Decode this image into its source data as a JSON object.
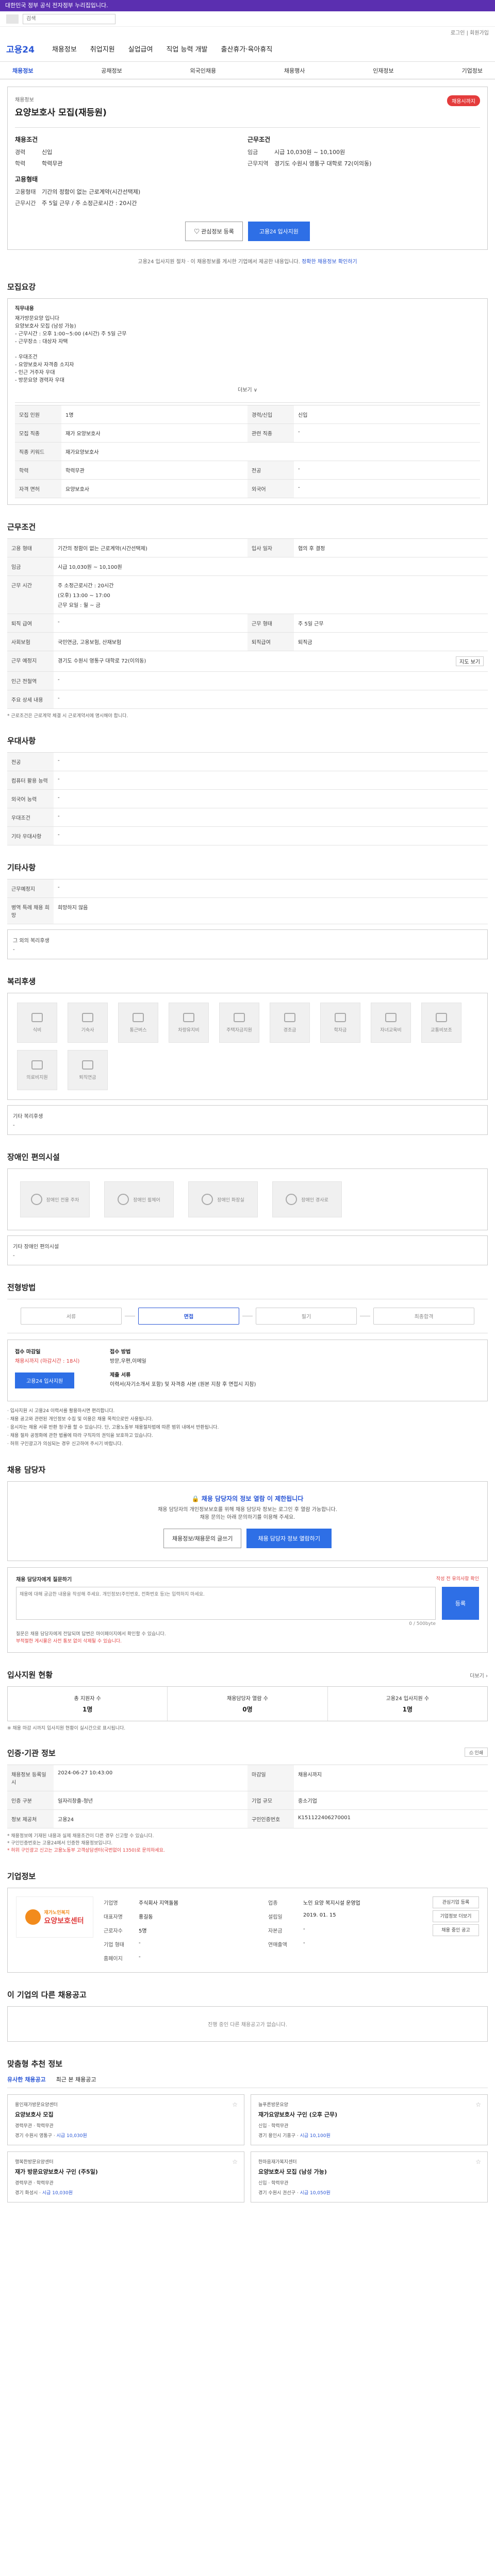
{
  "topbar": {
    "notice": "대한민국 정부 공식 전자정부 누리집입니다."
  },
  "search": {
    "placeholder": "검색"
  },
  "util": {
    "links": "로그인 | 회원가입"
  },
  "gnb": {
    "brand": "고용24",
    "menus": [
      "채용정보",
      "취업지원",
      "실업급여",
      "직업 능력 개발",
      "출산휴가·육아휴직"
    ]
  },
  "subnav": {
    "items": [
      "채용정보",
      "공채정보",
      "외국인채용",
      "채용행사",
      "인재정보",
      "기업정보"
    ],
    "active_index": 0
  },
  "job": {
    "category": "채용정보",
    "title": "요양보호사 모집(재등원)",
    "status": "채용시까지",
    "left_sub": "채용조건",
    "left": [
      {
        "k": "경력",
        "v": "신입"
      },
      {
        "k": "학력",
        "v": "학력무관"
      }
    ],
    "right_sub": "근무조건",
    "right": [
      {
        "k": "임금",
        "v": "시급 10,030원 ~ 10,100원"
      },
      {
        "k": "근무지역",
        "v": "경기도 수원시 영통구 대학로 72(이의동)"
      }
    ],
    "left2_sub": "고용형태",
    "left2": [
      {
        "k": "고용형태",
        "v": "기간의 정함이 없는 근로계약(시간선택제)"
      },
      {
        "k": "근무시간",
        "v": "주 5일 근무 / 주 소정근로시간 : 20시간"
      }
    ],
    "btn_bookmark": "관심정보 등록",
    "btn_apply": "고용24 입사지원",
    "note_pre": "고용24 입사지원 절차 · 이 채용정보를 게시한 기업에서 제공한 내용입니다.",
    "note_link": "정확한 채용정보 확인하기"
  },
  "recruit": {
    "title": "모집요강",
    "desc_label": "직무내용",
    "desc_lines": [
      "재가방문요양 입니다",
      "요양보호사 모집 (남성 가능)",
      "- 근무시간 : 오후 1:00~5:00 (4시간) 주 5일 근무",
      "- 근무장소 : 대상자 자택",
      "",
      "- 우대조건",
      "- 요양보호사 자격증 소지자",
      "- 인근 거주자 우대",
      "- 방문요양 경력자 우대"
    ],
    "more": "더보기 ∨",
    "rows": [
      [
        "모집 인원",
        "1명",
        "경력/신입",
        "신입"
      ],
      [
        "모집 직종",
        "재가 요양보호사",
        "관련 직종",
        "-"
      ],
      [
        "직종 키워드",
        "재가요양보호사",
        "",
        ""
      ],
      [
        "학력",
        "학력무관",
        "전공",
        "-"
      ],
      [
        "자격 면허",
        "요양보호사",
        "외국어",
        "-"
      ]
    ]
  },
  "work": {
    "title": "근무조건",
    "type_label": "고용 형태",
    "type_val": "기간의 정함이 없는 근로계약(시간선택제)",
    "start_label": "입사 일자",
    "start_val": "협의 후 결정",
    "pay_label": "임금",
    "pay_val": "시급 10,030원 ~ 10,100원",
    "hours_label": "근무 시간",
    "hours_val1": "주 소정근로시간 : 20시간",
    "hours_val2": "(오후) 13:00 ~ 17:00",
    "hours_val3": "근무 요일 : 월 ~ 금",
    "rows": [
      [
        "퇴직 급여",
        "-",
        "근무 형태",
        "주 5일 근무"
      ],
      [
        "사회보험",
        "국민연금, 고용보험, 산재보험",
        "퇴직급여",
        "퇴직금"
      ],
      [
        "근무 예정지",
        "경기도 수원시 영통구 대학로 72(이의동)",
        "",
        ""
      ],
      [
        "인근 전철역",
        "-",
        "",
        ""
      ],
      [
        "주요 상세 내용",
        "-",
        "",
        ""
      ]
    ],
    "map_btn": "지도 보기",
    "note": "* 근로조건은 근로계약 체결 시 근로계약서에 명시해야 합니다."
  },
  "pref": {
    "title": "우대사항",
    "rows": [
      [
        "전공",
        "-"
      ],
      [
        "컴퓨터 활용 능력",
        "-"
      ],
      [
        "외국어 능력",
        "-"
      ],
      [
        "우대조건",
        "-"
      ],
      [
        "기타 우대사항",
        "-"
      ]
    ]
  },
  "etc": {
    "title": "기타사항",
    "rows": [
      [
        "근무예정지",
        "-"
      ],
      [
        "병역 특례 채용 희망",
        "희망하지 않음"
      ]
    ],
    "more_label": "그 외의 복리후생",
    "more_val": "-"
  },
  "welfare": {
    "title": "복리후생",
    "tiles": [
      "식비",
      "기숙사",
      "통근버스",
      "차량유지비",
      "주택자금지원",
      "경조금",
      "학자금",
      "자녀교육비",
      "교통비보조",
      "의료비지원",
      "퇴직연금"
    ],
    "other_label": "기타 복리후생",
    "other_val": "-"
  },
  "facility": {
    "title": "장애인 편의시설",
    "tiles": [
      "장애인 전용 주차",
      "장애인 휠체어",
      "장애인 화장실",
      "장애인 경사로"
    ],
    "other_label": "기타 장애인 편의시설",
    "other_val": "-"
  },
  "process": {
    "title": "전형방법",
    "steps": [
      "서류",
      "면접",
      "필기",
      "최종합격"
    ],
    "active_index": 1,
    "apply_period_label": "접수 마감일",
    "apply_period": "채용시까지 (마감시간 : 18시)",
    "method_label": "접수 방법",
    "method": "방문,우편,이메일",
    "docs_label": "제출 서류",
    "docs": "이력서(자기소개서 포함) 및 자격증 사본 (원본 지참 후 면접시 지참)",
    "btn": "고용24 입사지원",
    "bullets": [
      "입사지원 시 고용24 이력서를 활용하시면 편리합니다.",
      "채용 공고와 관련된 개인정보 수집 및 이용은 채용 목적으로만 사용됩니다.",
      "응시자는 채용 서류 반환 청구를 할 수 있습니다. 단, 고용노동부 채용절차법에 따른 범위 내에서 반환됩니다.",
      "채용 절차 공정화에 관한 법률에 따라 구직자의 권익을 보호하고 있습니다.",
      "허위 구인광고가 의심되는 경우 신고하여 주시기 바랍니다."
    ]
  },
  "contact": {
    "title": "채용 담당자",
    "ct": "채용 담당자의 정보 열람 이 제한됩니다",
    "cs1": "채용 담당자의 개인정보보호를 위해 채용 담당자 정보는 로그인 후 열람 가능합니다.",
    "cs2": "채용 문의는 아래 문의하기를 이용해 주세요.",
    "btn1": "채용정보/채용문의 글쓰기",
    "btn2": "채용 담당자 정보 열람하기"
  },
  "qa": {
    "title": "채용 담당자에게 질문하기",
    "warn": "작성 전 유의사항 확인",
    "placeholder": "채용에 대해 궁금한 내용을 작성해 주세요. 개인정보(주민번호, 전화번호 등)는 입력하지 마세요.",
    "counter": "0 / 500byte",
    "reg": "등록",
    "notes": [
      "질문은 채용 담당자에게 전달되며 답변은 마이페이지에서 확인할 수 있습니다.",
      "부적절한 게시물은 사전 통보 없이 삭제될 수 있습니다."
    ]
  },
  "stats": {
    "title": "입사지원 현황",
    "more": "더보기 ›",
    "items": [
      {
        "l": "총 지원자 수",
        "v": "1명"
      },
      {
        "l": "채용담당자 열람 수",
        "v": "0명"
      },
      {
        "l": "고용24 입사지원 수",
        "v": "1명"
      }
    ],
    "note": "※ 채용 마감 시까지 입사지원 현황이 실시간으로 표시됩니다."
  },
  "info": {
    "title": "인증·기관 정보",
    "print": "인쇄",
    "rows": [
      [
        "채용정보 등록일시",
        "2024-06-27 10:43:00",
        "마감일",
        "채용시까지"
      ],
      [
        "인증 구분",
        "일자리창출-청년",
        "기업 규모",
        "중소기업"
      ],
      [
        "정보 제공처",
        "고용24",
        "구인인증번호",
        "K151122406270001"
      ]
    ],
    "notes": [
      "* 채용정보에 기재된 내용과 실제 채용조건이 다른 경우 신고할 수 있습니다.",
      "* 구인인증번호는 고용24에서 인증한 채용정보입니다.",
      "* 허위 구인광고 신고는 고용노동부 고객상담센터(국번없이 1350)로 문의하세요."
    ]
  },
  "company": {
    "title": "기업정보",
    "logo_text1": "재가노인복지",
    "logo_text2": "요양보호센터",
    "rows": [
      [
        "기업명",
        "주식회사 지역돌봄",
        "업종",
        "노인 요양 복지시설 운영업"
      ],
      [
        "대표자명",
        "홍길동",
        "설립일",
        "2019. 01. 15"
      ],
      [
        "근로자수",
        "5명",
        "자본금",
        "-"
      ],
      [
        "기업 형태",
        "-",
        "연매출액",
        "-"
      ],
      [
        "홈페이지",
        "-",
        "",
        ""
      ]
    ],
    "btns": [
      "관심기업 등록",
      "기업정보 더보기",
      "채용 중인 공고"
    ]
  },
  "other": {
    "title": "이 기업의 다른 채용공고",
    "empty": "진행 중인 다른 채용공고가 없습니다."
  },
  "recommend": {
    "title": "맞춤형 추천 정보",
    "tabs": [
      "유사한 채용공고",
      "최근 본 채용공고"
    ],
    "cards": [
      {
        "co": "용인재가방문요양센터",
        "jt": "요양보호사 모집",
        "meta1": "경력무관 · 학력무관",
        "meta2": "경기 수원시 영통구 · ",
        "meta3": "시급 10,030원"
      },
      {
        "co": "늘푸른방문요양",
        "jt": "재가요양보호사 구인 (오후 근무)",
        "meta1": "신입 · 학력무관",
        "meta2": "경기 용인시 기흥구 · ",
        "meta3": "시급 10,100원"
      },
      {
        "co": "행복한방문요양센터",
        "jt": "재가 방문요양보호사 구인 (주5일)",
        "meta1": "경력무관 · 학력무관",
        "meta2": "경기 화성시 · ",
        "meta3": "시급 10,030원"
      },
      {
        "co": "한마음재가복지센터",
        "jt": "요양보호사 모집 (남성 가능)",
        "meta1": "신입 · 학력무관",
        "meta2": "경기 수원시 권선구 · ",
        "meta3": "시급 10,050원"
      }
    ]
  }
}
